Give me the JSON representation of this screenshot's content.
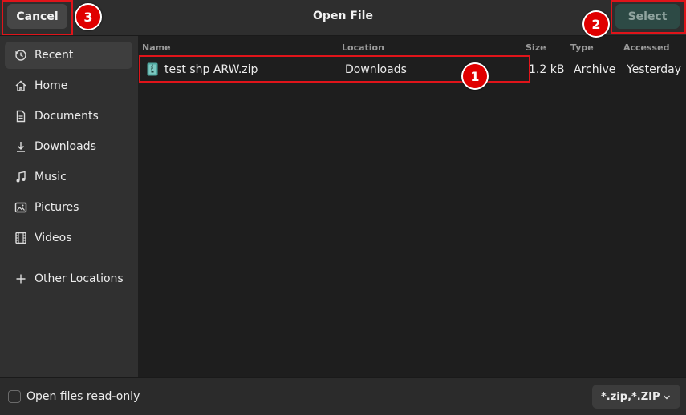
{
  "header": {
    "title": "Open File",
    "cancel_label": "Cancel",
    "select_label": "Select"
  },
  "sidebar": {
    "items": [
      {
        "label": "Recent",
        "icon": "clock-icon"
      },
      {
        "label": "Home",
        "icon": "home-icon"
      },
      {
        "label": "Documents",
        "icon": "document-icon"
      },
      {
        "label": "Downloads",
        "icon": "download-icon"
      },
      {
        "label": "Music",
        "icon": "music-note-icon"
      },
      {
        "label": "Pictures",
        "icon": "picture-icon"
      },
      {
        "label": "Videos",
        "icon": "film-icon"
      }
    ],
    "other_locations": {
      "label": "Other Locations",
      "icon": "plus-icon"
    }
  },
  "files": {
    "columns": [
      "Name",
      "Location",
      "Size",
      "Type",
      "Accessed"
    ],
    "rows": [
      {
        "name": "test shp ARW.zip",
        "location": "Downloads",
        "size": "1.2 kB",
        "type": "Archive",
        "accessed": "Yesterday",
        "icon": "zip-file-icon"
      }
    ]
  },
  "footer": {
    "readonly_label": "Open files read-only",
    "filter_label": "*.zip,*.ZIP"
  },
  "annotations": {
    "badge_1": "1",
    "badge_2": "2",
    "badge_3": "3"
  },
  "colors": {
    "highlight": "#e0141a",
    "badge": "#e00000",
    "select_button": "#2d4a45"
  }
}
